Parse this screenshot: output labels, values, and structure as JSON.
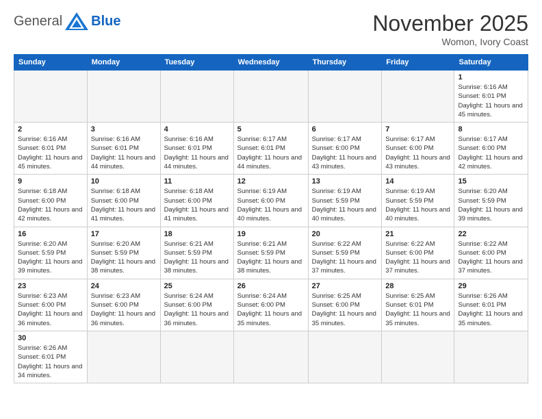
{
  "header": {
    "logo_general": "General",
    "logo_blue": "Blue",
    "month_title": "November 2025",
    "location": "Womon, Ivory Coast"
  },
  "weekdays": [
    "Sunday",
    "Monday",
    "Tuesday",
    "Wednesday",
    "Thursday",
    "Friday",
    "Saturday"
  ],
  "weeks": [
    [
      {
        "day": "",
        "empty": true
      },
      {
        "day": "",
        "empty": true
      },
      {
        "day": "",
        "empty": true
      },
      {
        "day": "",
        "empty": true
      },
      {
        "day": "",
        "empty": true
      },
      {
        "day": "",
        "empty": true
      },
      {
        "day": "1",
        "sunrise": "6:16 AM",
        "sunset": "6:01 PM",
        "daylight": "11 hours and 45 minutes."
      }
    ],
    [
      {
        "day": "2",
        "sunrise": "6:16 AM",
        "sunset": "6:01 PM",
        "daylight": "11 hours and 45 minutes."
      },
      {
        "day": "3",
        "sunrise": "6:16 AM",
        "sunset": "6:01 PM",
        "daylight": "11 hours and 44 minutes."
      },
      {
        "day": "4",
        "sunrise": "6:16 AM",
        "sunset": "6:01 PM",
        "daylight": "11 hours and 44 minutes."
      },
      {
        "day": "5",
        "sunrise": "6:17 AM",
        "sunset": "6:01 PM",
        "daylight": "11 hours and 44 minutes."
      },
      {
        "day": "6",
        "sunrise": "6:17 AM",
        "sunset": "6:00 PM",
        "daylight": "11 hours and 43 minutes."
      },
      {
        "day": "7",
        "sunrise": "6:17 AM",
        "sunset": "6:00 PM",
        "daylight": "11 hours and 43 minutes."
      },
      {
        "day": "8",
        "sunrise": "6:17 AM",
        "sunset": "6:00 PM",
        "daylight": "11 hours and 42 minutes."
      }
    ],
    [
      {
        "day": "9",
        "sunrise": "6:18 AM",
        "sunset": "6:00 PM",
        "daylight": "11 hours and 42 minutes."
      },
      {
        "day": "10",
        "sunrise": "6:18 AM",
        "sunset": "6:00 PM",
        "daylight": "11 hours and 41 minutes."
      },
      {
        "day": "11",
        "sunrise": "6:18 AM",
        "sunset": "6:00 PM",
        "daylight": "11 hours and 41 minutes."
      },
      {
        "day": "12",
        "sunrise": "6:19 AM",
        "sunset": "6:00 PM",
        "daylight": "11 hours and 40 minutes."
      },
      {
        "day": "13",
        "sunrise": "6:19 AM",
        "sunset": "5:59 PM",
        "daylight": "11 hours and 40 minutes."
      },
      {
        "day": "14",
        "sunrise": "6:19 AM",
        "sunset": "5:59 PM",
        "daylight": "11 hours and 40 minutes."
      },
      {
        "day": "15",
        "sunrise": "6:20 AM",
        "sunset": "5:59 PM",
        "daylight": "11 hours and 39 minutes."
      }
    ],
    [
      {
        "day": "16",
        "sunrise": "6:20 AM",
        "sunset": "5:59 PM",
        "daylight": "11 hours and 39 minutes."
      },
      {
        "day": "17",
        "sunrise": "6:20 AM",
        "sunset": "5:59 PM",
        "daylight": "11 hours and 38 minutes."
      },
      {
        "day": "18",
        "sunrise": "6:21 AM",
        "sunset": "5:59 PM",
        "daylight": "11 hours and 38 minutes."
      },
      {
        "day": "19",
        "sunrise": "6:21 AM",
        "sunset": "5:59 PM",
        "daylight": "11 hours and 38 minutes."
      },
      {
        "day": "20",
        "sunrise": "6:22 AM",
        "sunset": "5:59 PM",
        "daylight": "11 hours and 37 minutes."
      },
      {
        "day": "21",
        "sunrise": "6:22 AM",
        "sunset": "6:00 PM",
        "daylight": "11 hours and 37 minutes."
      },
      {
        "day": "22",
        "sunrise": "6:22 AM",
        "sunset": "6:00 PM",
        "daylight": "11 hours and 37 minutes."
      }
    ],
    [
      {
        "day": "23",
        "sunrise": "6:23 AM",
        "sunset": "6:00 PM",
        "daylight": "11 hours and 36 minutes."
      },
      {
        "day": "24",
        "sunrise": "6:23 AM",
        "sunset": "6:00 PM",
        "daylight": "11 hours and 36 minutes."
      },
      {
        "day": "25",
        "sunrise": "6:24 AM",
        "sunset": "6:00 PM",
        "daylight": "11 hours and 36 minutes."
      },
      {
        "day": "26",
        "sunrise": "6:24 AM",
        "sunset": "6:00 PM",
        "daylight": "11 hours and 35 minutes."
      },
      {
        "day": "27",
        "sunrise": "6:25 AM",
        "sunset": "6:00 PM",
        "daylight": "11 hours and 35 minutes."
      },
      {
        "day": "28",
        "sunrise": "6:25 AM",
        "sunset": "6:01 PM",
        "daylight": "11 hours and 35 minutes."
      },
      {
        "day": "29",
        "sunrise": "6:26 AM",
        "sunset": "6:01 PM",
        "daylight": "11 hours and 35 minutes."
      }
    ],
    [
      {
        "day": "30",
        "sunrise": "6:26 AM",
        "sunset": "6:01 PM",
        "daylight": "11 hours and 34 minutes."
      },
      {
        "day": "",
        "empty": true
      },
      {
        "day": "",
        "empty": true
      },
      {
        "day": "",
        "empty": true
      },
      {
        "day": "",
        "empty": true
      },
      {
        "day": "",
        "empty": true
      },
      {
        "day": "",
        "empty": true
      }
    ]
  ],
  "labels": {
    "sunrise": "Sunrise: ",
    "sunset": "Sunset: ",
    "daylight": "Daylight: "
  }
}
